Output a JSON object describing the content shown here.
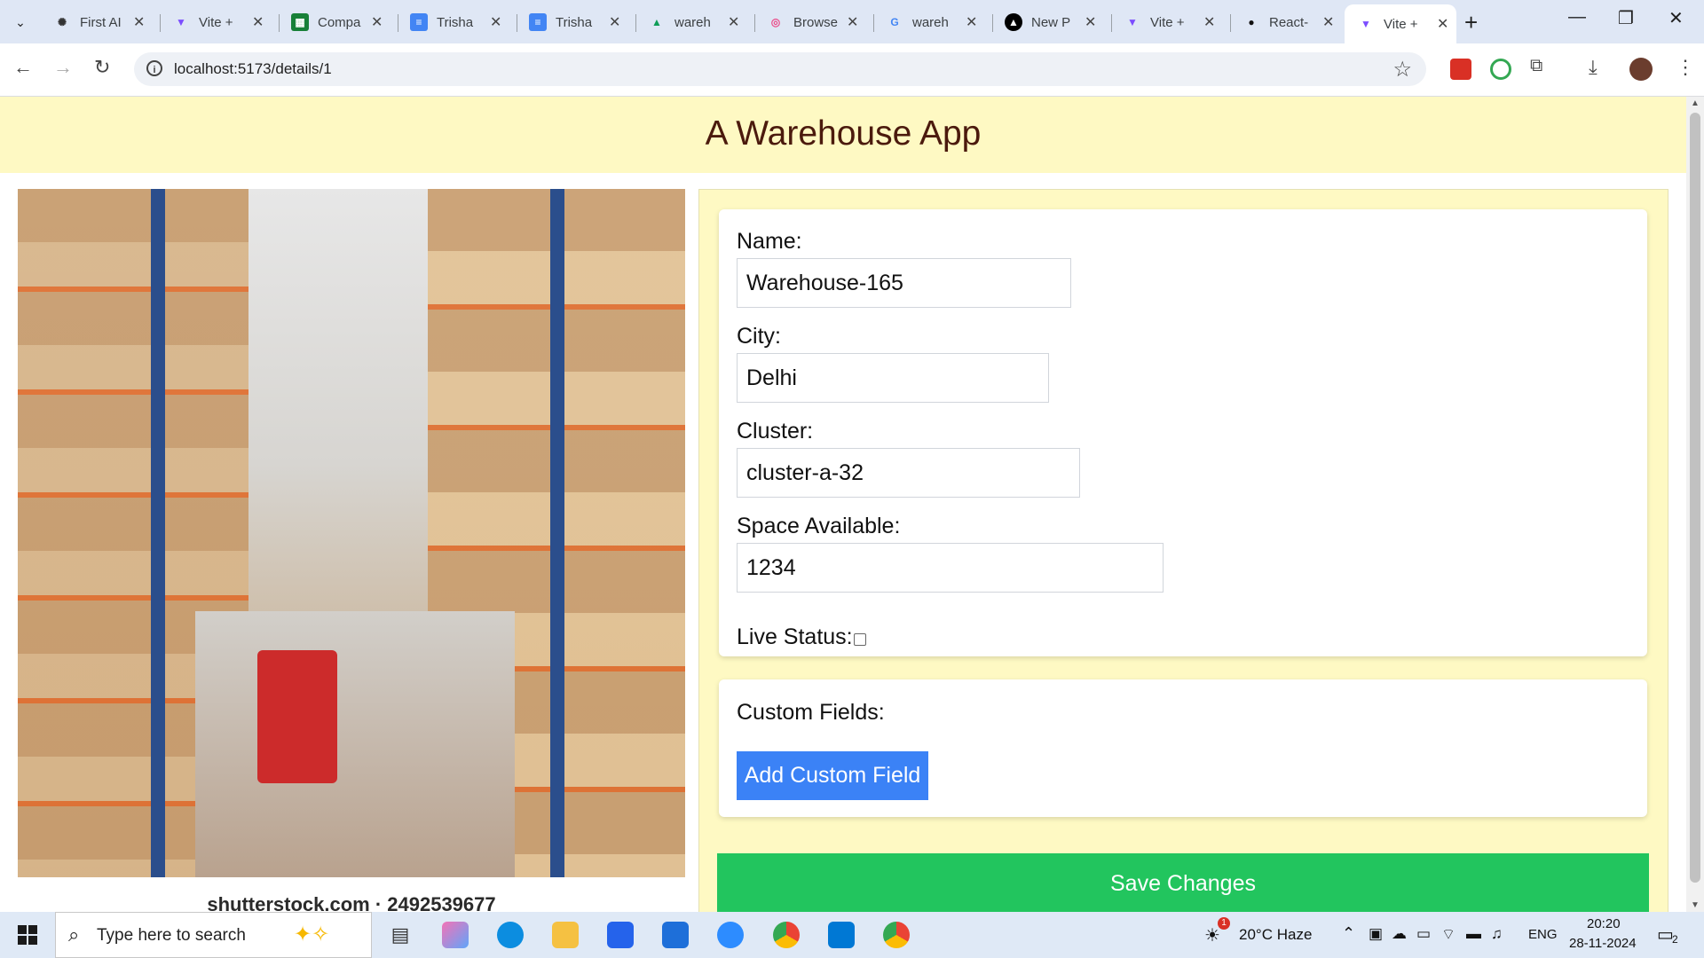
{
  "browser": {
    "tabs": [
      {
        "title": "First AI",
        "icon": "openai-icon"
      },
      {
        "title": "Vite +",
        "icon": "vite-icon"
      },
      {
        "title": "Compa",
        "icon": "sheets-icon"
      },
      {
        "title": "Trisha",
        "icon": "docs-icon"
      },
      {
        "title": "Trisha",
        "icon": "docs-icon"
      },
      {
        "title": "wareh",
        "icon": "drive-icon"
      },
      {
        "title": "Browse",
        "icon": "dribbble-icon"
      },
      {
        "title": "wareh",
        "icon": "google-icon"
      },
      {
        "title": "New P",
        "icon": "vercel-icon"
      },
      {
        "title": "Vite +",
        "icon": "vite-icon"
      },
      {
        "title": "React-",
        "icon": "github-icon"
      },
      {
        "title": "Vite +",
        "icon": "vite-icon"
      }
    ],
    "url": "localhost:5173/details/1"
  },
  "app": {
    "title": "A Warehouse App",
    "image_caption": "shutterstock.com · 2492539677",
    "form": {
      "name_label": "Name:",
      "name_value": "Warehouse-165",
      "city_label": "City:",
      "city_value": "Delhi",
      "cluster_label": "Cluster:",
      "cluster_value": "cluster-a-32",
      "space_label": "Space Available:",
      "space_value": "1234",
      "live_label": "Live Status:"
    },
    "custom_fields_label": "Custom Fields:",
    "add_custom_field_label": "Add Custom Field",
    "save_label": "Save Changes"
  },
  "taskbar": {
    "search_placeholder": "Type here to search",
    "weather": "20°C  Haze",
    "weather_badge": "1",
    "language": "ENG",
    "time": "20:20",
    "date": "28-11-2024",
    "notification_count": "2"
  },
  "colors": {
    "header_bg": "#fef9c3",
    "add_button": "#3b82f6",
    "save_button": "#22c55e"
  }
}
